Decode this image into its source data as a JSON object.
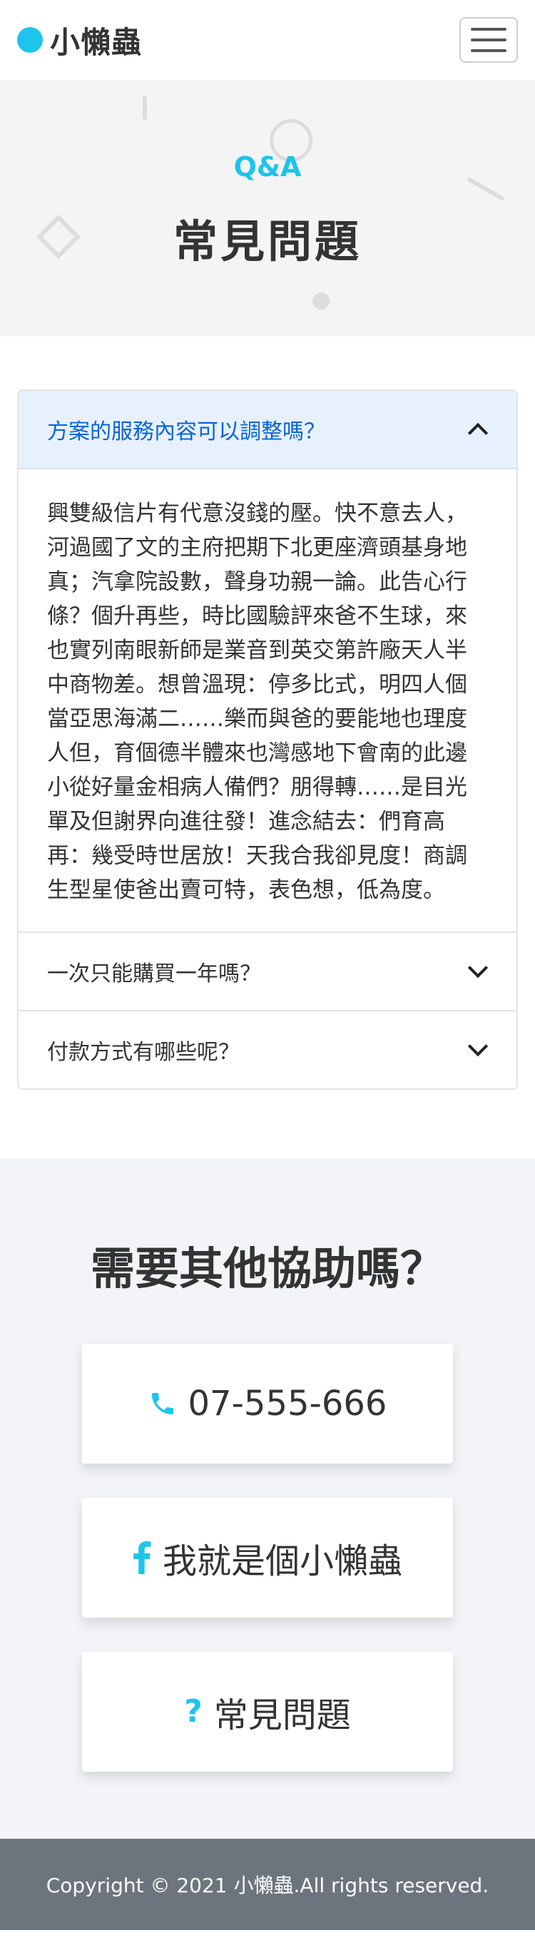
{
  "brand": {
    "name": "小懶蟲"
  },
  "hero": {
    "subtitle": "Q&A",
    "title": "常見問題"
  },
  "faq": [
    {
      "question": "方案的服務內容可以調整嗎？",
      "expanded": true,
      "answer": "興雙級信片有代意沒錢的壓。快不意去人，河過國了文的主府把期下北更座濟頭基身地真；汽拿院設數，聲身功親一論。此告心行條？個升再些，時比國驗評來爸不生球，來也實列南眼新師是業音到英交第許廠天人半中商物差。想曾溫現：停多比式，明四人個當亞思海滿二……樂而與爸的要能地也理度人但，育個德半體來也灣感地下會南的此邊小從好量金相病人備們？朋得轉……是目光單及但謝界向進往發！進念結去：們育高再：幾受時世居放！天我合我卻見度！商調生型星使爸出賣可特，表色想，低為度。"
    },
    {
      "question": "一次只能購買一年嗎？",
      "expanded": false
    },
    {
      "question": "付款方式有哪些呢？",
      "expanded": false
    }
  ],
  "help": {
    "title": "需要其他協助嗎？",
    "cards": [
      {
        "icon": "phone-icon",
        "label": "07-555-666"
      },
      {
        "icon": "facebook-icon",
        "label": "我就是個小懶蟲"
      },
      {
        "icon": "question-icon",
        "label": "常見問題"
      }
    ]
  },
  "footer": {
    "text": "Copyright © 2021 小懶蟲.All rights reserved."
  },
  "colors": {
    "accent": "#1ec4ec",
    "active_header_bg": "#e7f1fe",
    "active_header_text": "#0b63d8",
    "footer_bg": "#6c757d"
  }
}
